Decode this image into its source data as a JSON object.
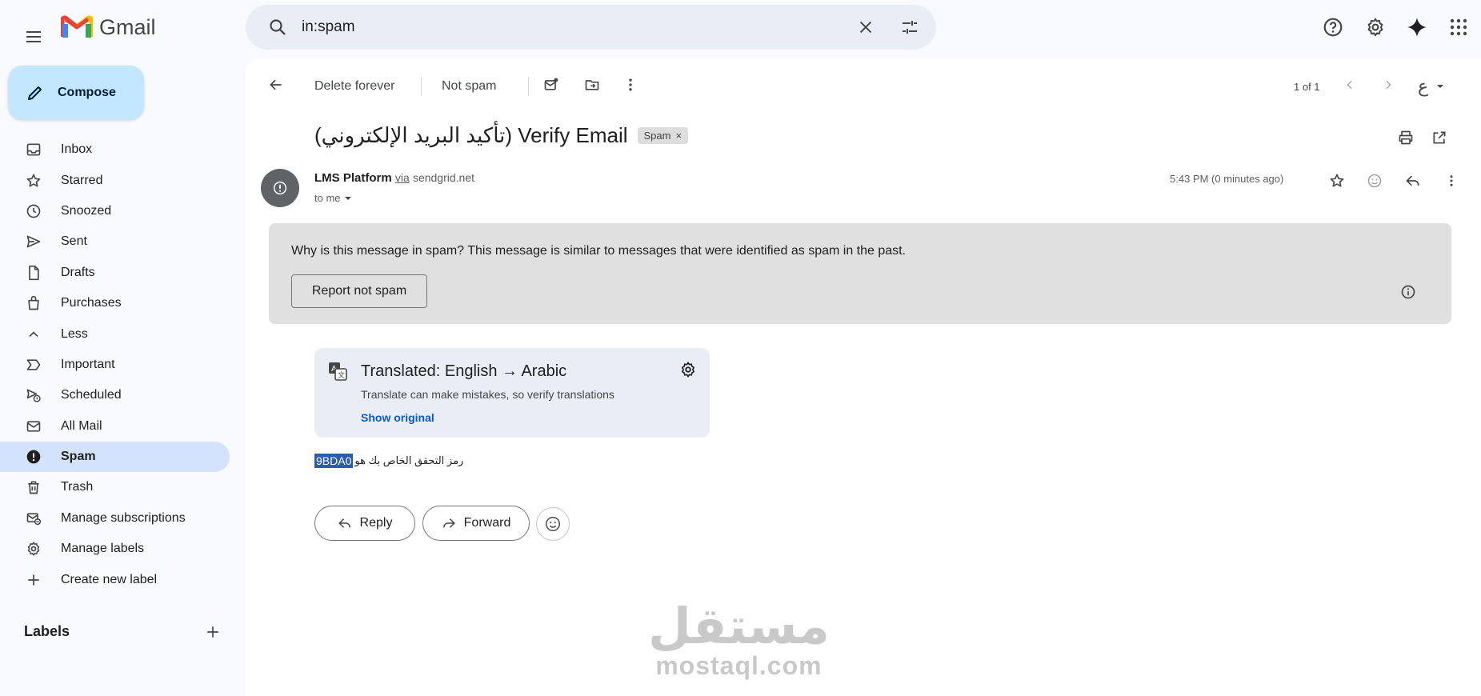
{
  "app": {
    "name": "Gmail"
  },
  "search": {
    "value": "in:spam"
  },
  "sidebar": {
    "compose_label": "Compose",
    "items": [
      {
        "label": "Inbox",
        "icon": "inbox-icon"
      },
      {
        "label": "Starred",
        "icon": "star-icon"
      },
      {
        "label": "Snoozed",
        "icon": "clock-icon"
      },
      {
        "label": "Sent",
        "icon": "send-icon"
      },
      {
        "label": "Drafts",
        "icon": "draft-icon"
      },
      {
        "label": "Purchases",
        "icon": "bag-icon"
      },
      {
        "label": "Less",
        "icon": "chevron-up-icon"
      },
      {
        "label": "Important",
        "icon": "important-icon"
      },
      {
        "label": "Scheduled",
        "icon": "scheduled-icon"
      },
      {
        "label": "All Mail",
        "icon": "all-mail-icon"
      },
      {
        "label": "Spam",
        "icon": "spam-icon",
        "active": true
      },
      {
        "label": "Trash",
        "icon": "trash-icon"
      },
      {
        "label": "Manage subscriptions",
        "icon": "subscriptions-icon"
      },
      {
        "label": "Manage labels",
        "icon": "gear-icon"
      },
      {
        "label": "Create new label",
        "icon": "plus-icon"
      }
    ],
    "labels_heading": "Labels"
  },
  "toolbar": {
    "delete_forever": "Delete forever",
    "not_spam": "Not spam",
    "pagination": "1 of 1",
    "input_tool": "ع"
  },
  "message": {
    "subject": "(تأكيد البريد الإلكتروني) Verify Email",
    "spam_chip": "Spam",
    "sender_name": "LMS Platform",
    "via": "via",
    "sender_domain": "sendgrid.net",
    "to": "to me",
    "time": "5:43 PM (0 minutes ago)",
    "spam_notice_q": "Why is this message in spam?",
    "spam_notice_a": "This message is similar to messages that were identified as spam in the past.",
    "report_not_spam": "Report not spam",
    "translation_title": "Translated: English → Arabic",
    "translation_sub": "Translate can make mistakes, so verify translations",
    "show_original": "Show original",
    "body_text": "رمز التحقق الخاص بك هو",
    "code": "9BDA0",
    "reply": "Reply",
    "forward": "Forward"
  },
  "watermark": {
    "arabic": "مستقل",
    "latin": "mostaql.com"
  },
  "colors": {
    "accent": "#0b57d0",
    "compose": "#c2e7ff",
    "active_nav": "#d3e3fd",
    "background": "#f8fafd"
  }
}
